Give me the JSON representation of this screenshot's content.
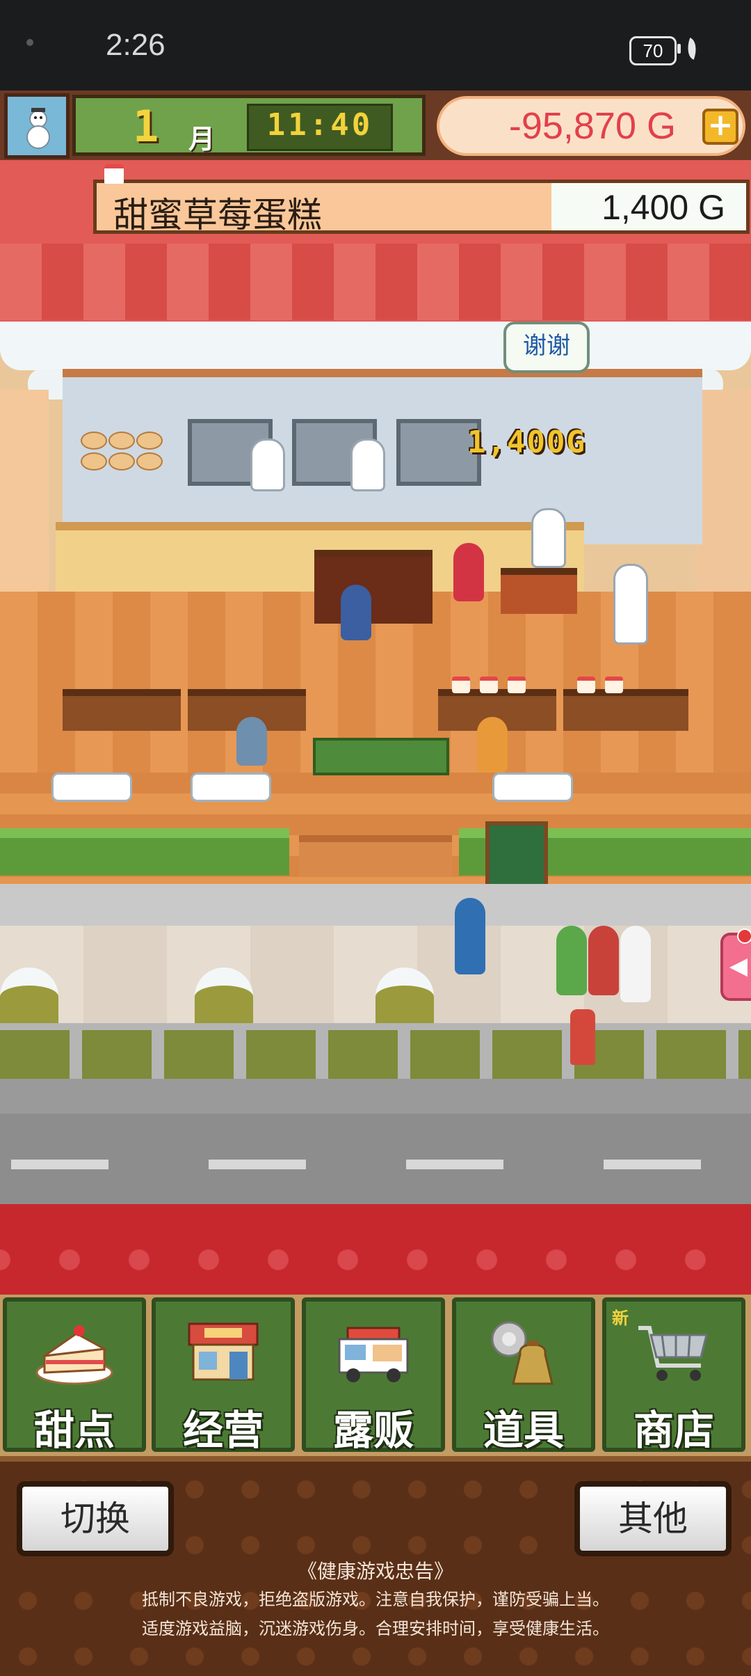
{
  "status_bar": {
    "time": "2:26",
    "battery": "70"
  },
  "hud": {
    "month_number": "1",
    "month_label": "月",
    "clock": "11:40",
    "money": "-95,870 G",
    "add_symbol": "+"
  },
  "product": {
    "name": "甜蜜草莓蛋糕",
    "price": "1,400 G"
  },
  "scene": {
    "speech": "谢谢",
    "sale_popup": "1,400G",
    "side_tab_arrow": "◀"
  },
  "menu": {
    "items": [
      {
        "label": "甜点",
        "icon": "cake-icon"
      },
      {
        "label": "经营",
        "icon": "shop-icon"
      },
      {
        "label": "露贩",
        "icon": "food-truck-icon"
      },
      {
        "label": "道具",
        "icon": "item-bag-icon"
      },
      {
        "label": "商店",
        "icon": "cart-icon",
        "badge": "新"
      }
    ]
  },
  "bottom": {
    "switch_label": "切换",
    "other_label": "其他",
    "notice_title": "《健康游戏忠告》",
    "notice_line1": "抵制不良游戏，拒绝盗版游戏。注意自我保护，谨防受骗上当。",
    "notice_line2": "适度游戏益脑，沉迷游戏伤身。合理安排时间，享受健康生活。"
  },
  "colors": {
    "money_negative": "#e2404b",
    "menu_green": "#4c7a34",
    "clock_gold": "#f2d23b"
  }
}
